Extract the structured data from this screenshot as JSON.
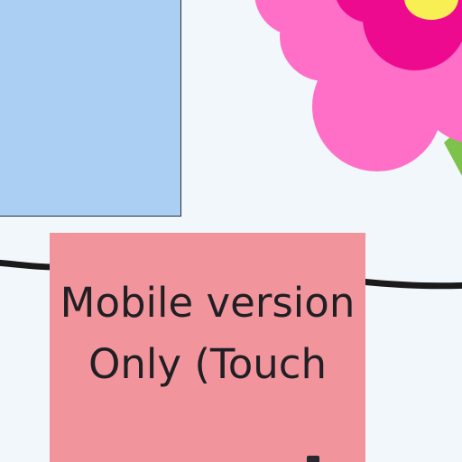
{
  "canvas": {
    "background": "#f2f7fc"
  },
  "sticky_notes": [
    {
      "color": "#abcff3",
      "text": ""
    },
    {
      "color": "#f1949b",
      "text": "Mobile version Only (Touch"
    }
  ],
  "sticker": {
    "name": "flower",
    "petal_color": "#ff6ec7",
    "inner_color": "#ee0a8e",
    "center_color": "#f8ef55",
    "stem_color": "#7dc24b"
  },
  "connector_color": "#1a1a1a"
}
